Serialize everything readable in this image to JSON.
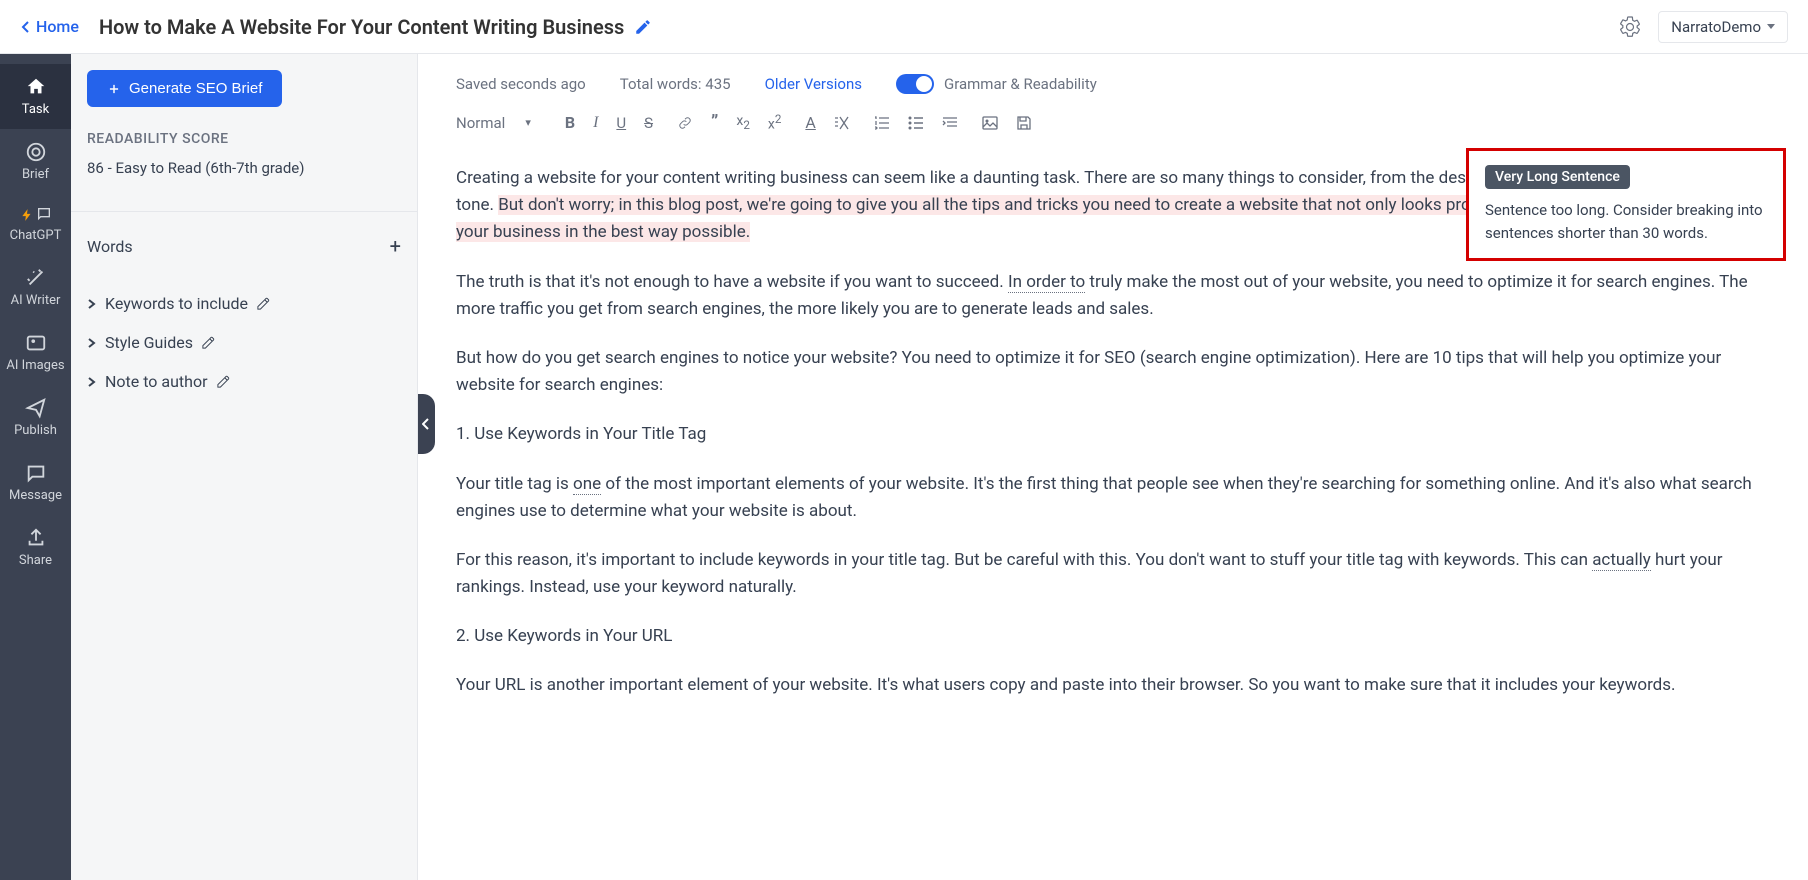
{
  "header": {
    "home": "Home",
    "title": "How to Make A Website For Your Content Writing Business",
    "workspace": "NarratoDemo"
  },
  "rail": {
    "task": "Task",
    "brief": "Brief",
    "chatgpt": "ChatGPT",
    "aiwriter": "AI Writer",
    "aiimages": "AI Images",
    "publish": "Publish",
    "message": "Message",
    "share": "Share"
  },
  "sidebar": {
    "seo_btn": "Generate SEO Brief",
    "readability_title": "READABILITY SCORE",
    "readability_value": "86 - Easy to Read (6th-7th grade)",
    "words": "Words",
    "keywords": "Keywords to include",
    "style_guides": "Style Guides",
    "note_author": "Note to author"
  },
  "topbar": {
    "saved": "Saved seconds ago",
    "total_words": "Total words: 435",
    "older": "Older Versions",
    "grammar": "Grammar & Readability"
  },
  "toolbar": {
    "format": "Normal"
  },
  "callout": {
    "badge": "Very Long Sentence",
    "text": "Sentence too long. Consider breaking into sentences shorter than 30 words."
  },
  "editor": {
    "p1a": "Creating a website for your content writing business can seem like a daunting task. There are so many things to consider, from the design and structure to the navigation and tone. ",
    "p1b": "But don't worry; in this blog post, we're going to give you all the tips and tricks you need to create a website that not only looks professiona",
    "p1c": "l, but also represents you and your business in the best way possible.",
    "p2a": "The truth is that it's not enough to have a website if you want to succeed. ",
    "p2b": "In order to",
    "p2c": " truly make the most out of your website, you need to optimize it for search engines. The more traffic you get from search engines, the more likely you are to generate leads and sales.",
    "p3": "But how do you get search engines to notice your website? You need to optimize it for SEO (search engine optimization). Here are 10 tips that will help you optimize your website for search engines:",
    "p4": "1. Use Keywords in Your Title Tag",
    "p5a": "Your title tag is ",
    "p5b": "one",
    "p5c": " of the most important elements of your website. It's the first thing that people see when they're searching for something online. And it's also what search engines use to determine what your website is about.",
    "p6a": "For this reason, it's important to include keywords in your title tag. But be careful with this. You don't want to stuff your title tag with keywords. This can ",
    "p6b": "actually",
    "p6c": " hurt your rankings. Instead, use your keyword naturally.",
    "p7": "2. Use Keywords in Your URL",
    "p8": "Your URL is another important element of your website. It's what users copy and paste into their browser. So you want to make sure that it includes your keywords."
  }
}
